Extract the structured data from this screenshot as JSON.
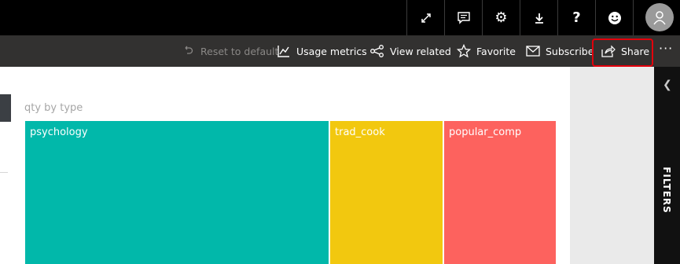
{
  "toolbar": {
    "reset_label": "Reset to default",
    "usage_label": "Usage metrics",
    "related_label": "View related",
    "favorite_label": "Favorite",
    "subscribe_label": "Subscribe",
    "share_label": "Share",
    "more_label": "···"
  },
  "visual": {
    "title": "qty by type",
    "cells": [
      {
        "label": "psychology",
        "color": "#01b8aa"
      },
      {
        "label": "trad_cook",
        "color": "#f2c80f"
      },
      {
        "label": "popular_comp",
        "color": "#fd625e"
      }
    ]
  },
  "filters": {
    "label": "FILTERS"
  },
  "colors": {
    "highlight": "#e3000b"
  }
}
